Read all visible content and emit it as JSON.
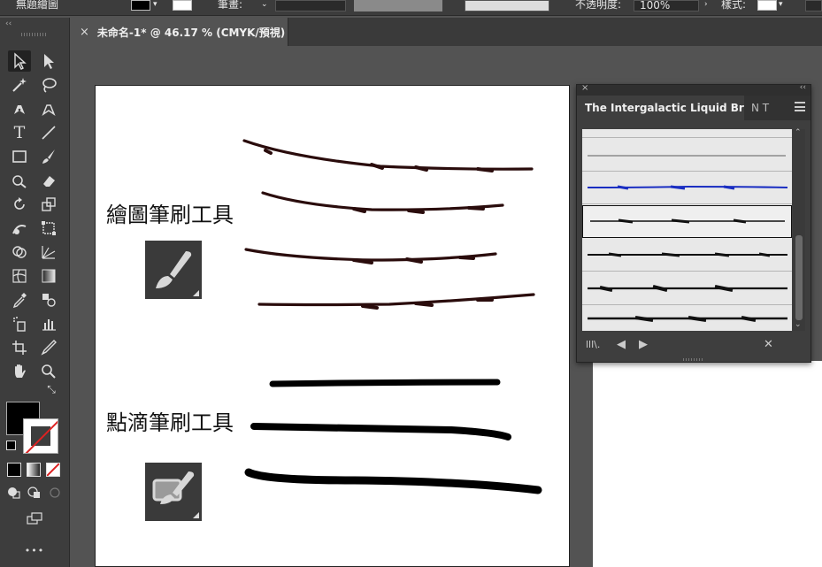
{
  "topbar": {
    "left_label": "無題繪圖",
    "opacity_label": "不透明度:",
    "opacity_value": "100%",
    "style_label": "樣式:",
    "stroke_label": "筆畫:"
  },
  "document_tab": {
    "close": "×",
    "title": "未命名-1* @ 46.17 % (CMYK/預視)"
  },
  "canvas": {
    "paint_brush_label": "繪圖筆刷工具",
    "blob_brush_label": "點滴筆刷工具"
  },
  "brushes_panel": {
    "close": "×",
    "collapse": "‹‹",
    "active_tab": "The Intergalactic Liquid Bru...",
    "other_tabs": "N T",
    "brush_rows": [
      {
        "name": "thin-grey-line",
        "selected": false
      },
      {
        "name": "blue-liquid",
        "selected": false
      },
      {
        "name": "black-liquid-1",
        "selected": true
      },
      {
        "name": "black-liquid-2",
        "selected": false
      },
      {
        "name": "black-liquid-3",
        "selected": false
      },
      {
        "name": "black-liquid-4",
        "selected": false
      }
    ]
  },
  "toolbar": {
    "collapse": "‹‹",
    "more": "•••"
  },
  "colors": {
    "ui_dark": "#3d3d3d",
    "canvas_bg": "#535353",
    "artboard": "#ffffff",
    "stroke_dark_red": "#2a0c0c",
    "brush_blue": "#1a2ec2"
  }
}
